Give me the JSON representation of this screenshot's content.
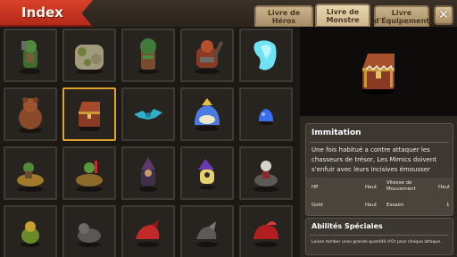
{
  "header": {
    "title": "Index"
  },
  "tabs": [
    {
      "label": "Livre de Héros",
      "active": false
    },
    {
      "label": "Livre de Monstre",
      "active": true
    },
    {
      "label": "Livre d'Équipement",
      "active": false
    }
  ],
  "close_icon": "close-x-icon",
  "grid": {
    "selected_index": 6,
    "monsters": [
      "green-orc-warrior-icon",
      "stone-golem-icon",
      "moss-treant-icon",
      "red-armored-ogre-icon",
      "ice-spirit-icon",
      "brown-bear-icon",
      "mimic-chest-icon",
      "blue-bat-icon",
      "blue-slime-icon",
      "small-blue-slime-icon",
      "goblin-rider-icon",
      "goblin-rider-scout-icon",
      "dark-witch-icon",
      "purple-wizard-icon",
      "skull-rider-icon",
      "green-frog-icon",
      "grey-wolf-icon",
      "red-dragon-icon",
      "grey-drake-icon",
      "crimson-beast-icon"
    ]
  },
  "detail": {
    "name": "Immitation",
    "description": "Une fois habitué a contre attaquer les chasseurs de trésor, Les Mimics doivent s'enfuir avec leurs incisives émousser",
    "stats": {
      "hp_label": "HP",
      "hp_value": "Haut",
      "speed_label": "Vitesse de Mouvement",
      "speed_value": "Haut",
      "gold_label": "Gold",
      "gold_value": "Haut",
      "swarm_label": "Essaim",
      "swarm_value": "1"
    },
    "abilities_title": "Abilités Spéciales",
    "abilities_text": "Laisse tomber unes grande quantité d'Or pour chaque attaque."
  },
  "colors": {
    "ribbon": "#c7331f",
    "selected_border": "#e0a32a",
    "tab": "#c9b38a"
  }
}
